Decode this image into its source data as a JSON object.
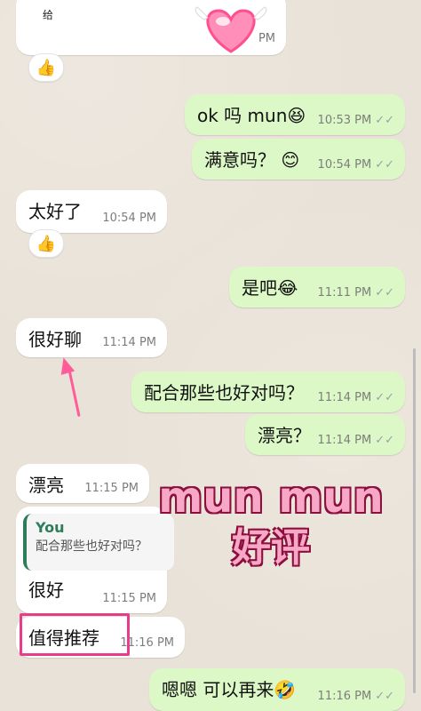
{
  "colors": {
    "incoming": "#ffffff",
    "outgoing": "#dcf8c6",
    "time": "#7d7d7d",
    "highlight": "#e93b8c",
    "overlay_fill": "#f7a8c7",
    "overlay_stroke": "#8b0f3d"
  },
  "top": {
    "partial_text": "给",
    "partial_time_fragment": "PM",
    "reaction": "👍"
  },
  "messages": [
    {
      "text": "ok 吗 mun😆",
      "time": "10:53 PM"
    },
    {
      "text": "满意吗？ 😊",
      "time": "10:54 PM"
    },
    {
      "text": "太好了",
      "time": "10:54 PM",
      "reaction": "👍"
    },
    {
      "text": "是吧😂",
      "time": "11:11 PM"
    },
    {
      "text": "很好聊",
      "time": "11:14 PM"
    },
    {
      "text": "配合那些也好对吗？",
      "time": "11:14 PM"
    },
    {
      "text": "漂亮？",
      "time": "11:14 PM"
    },
    {
      "text": "漂亮",
      "time": "11:15 PM"
    },
    {
      "quote_author": "You",
      "quote_text": "配合那些也好对吗？",
      "text": "很好",
      "time": "11:15 PM"
    },
    {
      "text": "值得推荐",
      "time": "11:16 PM"
    },
    {
      "text": "嗯嗯 可以再来🤣",
      "time": "11:16 PM"
    }
  ],
  "overlay": {
    "line1": "mun mun",
    "line2": "好评"
  },
  "icons": {
    "read_ticks": "double-check-icon",
    "heart": "heart-sticker-icon",
    "arrow": "pink-arrow-icon"
  }
}
